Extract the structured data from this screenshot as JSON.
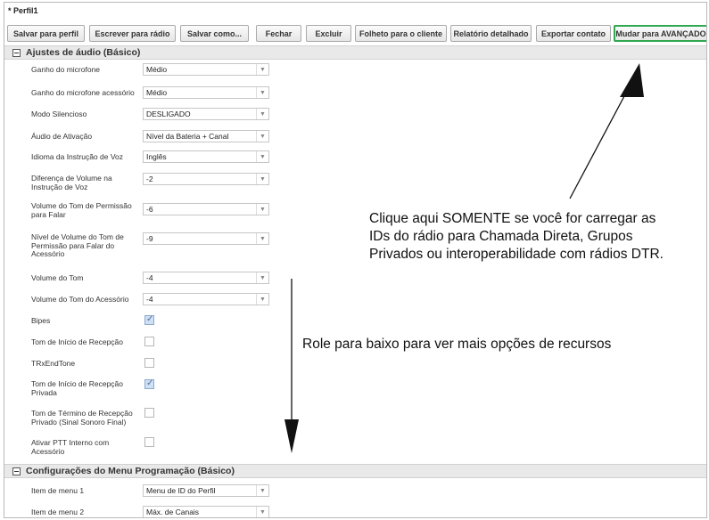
{
  "tab_title": "* Perfil1",
  "toolbar": {
    "buttons": [
      "Salvar para perfil",
      "Escrever para rádio",
      "Salvar como...",
      "Fechar",
      "Excluir",
      "Folheto para o cliente",
      "Relatório detalhado",
      "Exportar contato",
      "Mudar para AVANÇADO"
    ]
  },
  "sections": {
    "audio": {
      "title": "Ajustes de áudio (Básico)",
      "rows": [
        {
          "label": "Ganho do microfone",
          "type": "select",
          "value": "Médio"
        },
        {
          "label": "Ganho do microfone acessório",
          "type": "select",
          "value": "Médio"
        },
        {
          "label": "Modo Silencioso",
          "type": "select",
          "value": "DESLIGADO"
        },
        {
          "label": "Áudio de Ativação",
          "type": "select",
          "value": "Nível da Bateria + Canal"
        },
        {
          "label": "Idioma da Instrução de Voz",
          "type": "select",
          "value": "Inglês"
        },
        {
          "label": "Diferença de Volume na Instrução de Voz",
          "type": "select",
          "value": "-2"
        },
        {
          "label": "Volume do Tom de Permissão para Falar",
          "type": "select",
          "value": "-6"
        },
        {
          "label": "Nível de Volume do Tom de Permissão para Falar do Acessório",
          "type": "select",
          "value": "-9"
        },
        {
          "label": "Volume do Tom",
          "type": "select",
          "value": "-4"
        },
        {
          "label": "Volume do Tom do Acessório",
          "type": "select",
          "value": "-4"
        },
        {
          "label": "Bipes",
          "type": "checkbox",
          "checked": true
        },
        {
          "label": "Tom de Início de Recepção",
          "type": "checkbox",
          "checked": false
        },
        {
          "label": "TRxEndTone",
          "type": "checkbox",
          "checked": false
        },
        {
          "label": "Tom de Início de Recepção Privada",
          "type": "checkbox",
          "checked": true
        },
        {
          "label": "Tom de Término de Recepção Privado (Sinal Sonoro Final)",
          "type": "checkbox",
          "checked": false
        },
        {
          "label": "Ativar PTT Interno com Acessório",
          "type": "checkbox",
          "checked": false
        }
      ]
    },
    "menu": {
      "title": "Configurações do Menu Programação (Básico)",
      "rows": [
        {
          "label": "Item de menu 1",
          "type": "select",
          "value": "Menu de ID do Perfil"
        },
        {
          "label": "Item de menu 2",
          "type": "select",
          "value": "Máx. de Canais"
        }
      ]
    }
  },
  "annotations": {
    "advanced_note": "Clique aqui SOMENTE se você for carregar as IDs do rádio para Chamada Direta, Grupos Privados ou interoperabilidade com rádios DTR.",
    "scroll_note": "Role para baixo para ver mais opções de recursos"
  }
}
